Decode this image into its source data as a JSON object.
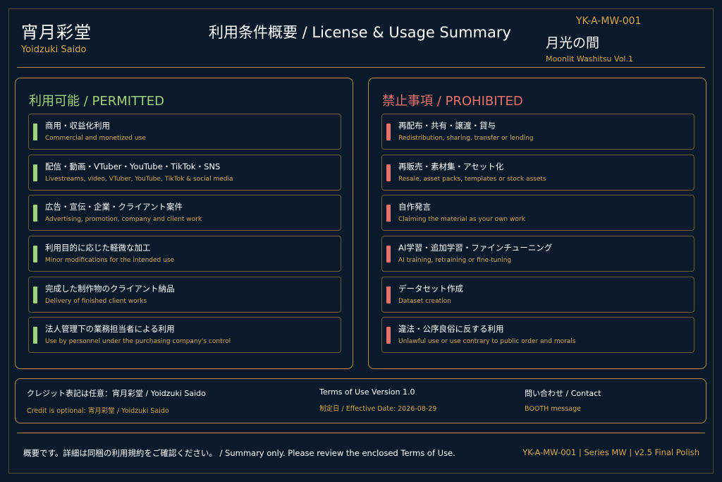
{
  "header": {
    "brand_jp": "宵月彩堂",
    "brand_en": "Yoidzuki Saido",
    "title": "利用条件概要 / License & Usage Summary",
    "code": "YK-A-MW-001",
    "product_jp": "月光の間",
    "product_en": "Moonlit Washitsu Vol.1"
  },
  "permitted": {
    "heading": "利用可能 / PERMITTED",
    "items": [
      {
        "jp": "商用・収益化利用",
        "en": "Commercial and monetized use"
      },
      {
        "jp": "配信・動画・VTuber・YouTube・TikTok・SNS",
        "en": "Livestreams, video, VTuber, YouTube, TikTok & social media"
      },
      {
        "jp": "広告・宣伝・企業・クライアント案件",
        "en": "Advertising, promotion, company and client work"
      },
      {
        "jp": "利用目的に応じた軽微な加工",
        "en": "Minor modifications for the intended use"
      },
      {
        "jp": "完成した制作物のクライアント納品",
        "en": "Delivery of finished client works"
      },
      {
        "jp": "法人管理下の業務担当者による利用",
        "en": "Use by personnel under the purchasing company's control"
      }
    ]
  },
  "prohibited": {
    "heading": "禁止事項 / PROHIBITED",
    "items": [
      {
        "jp": "再配布・共有・譲渡・貸与",
        "en": "Redistribution, sharing, transfer or lending"
      },
      {
        "jp": "再販売・素材集・アセット化",
        "en": "Resale, asset packs, templates or stock assets"
      },
      {
        "jp": "自作発言",
        "en": "Claiming the material as your own work"
      },
      {
        "jp": "AI学習・追加学習・ファインチューニング",
        "en": "AI training, retraining or fine-tuning"
      },
      {
        "jp": "データセット作成",
        "en": "Dataset creation"
      },
      {
        "jp": "違法・公序良俗に反する利用",
        "en": "Unlawful use or use contrary to public order and morals"
      }
    ]
  },
  "info": {
    "credit_main": "クレジット表記は任意：宵月彩堂 / Yoidzuki Saido",
    "credit_sub": "Credit is optional: 宵月彩堂 / Yoidzuki Saido",
    "terms_main": "Terms of Use Version 1.0",
    "terms_sub": "制定日 / Effective Date: 2026-08-29",
    "contact_main": "問い合わせ / Contact",
    "contact_sub": "BOOTH message"
  },
  "footer": {
    "note": "概要です。詳細は同梱の利用規約をご確認ください。 / Summary only. Please review the enclosed Terms of Use.",
    "meta": "YK-A-MW-001  |  Series MW  |  v2.5 Final Polish"
  },
  "colors": {
    "background": "#0b1a2a",
    "gold": "#d7a64a",
    "permitted": "#9fd27a",
    "prohibited": "#e8706a"
  }
}
